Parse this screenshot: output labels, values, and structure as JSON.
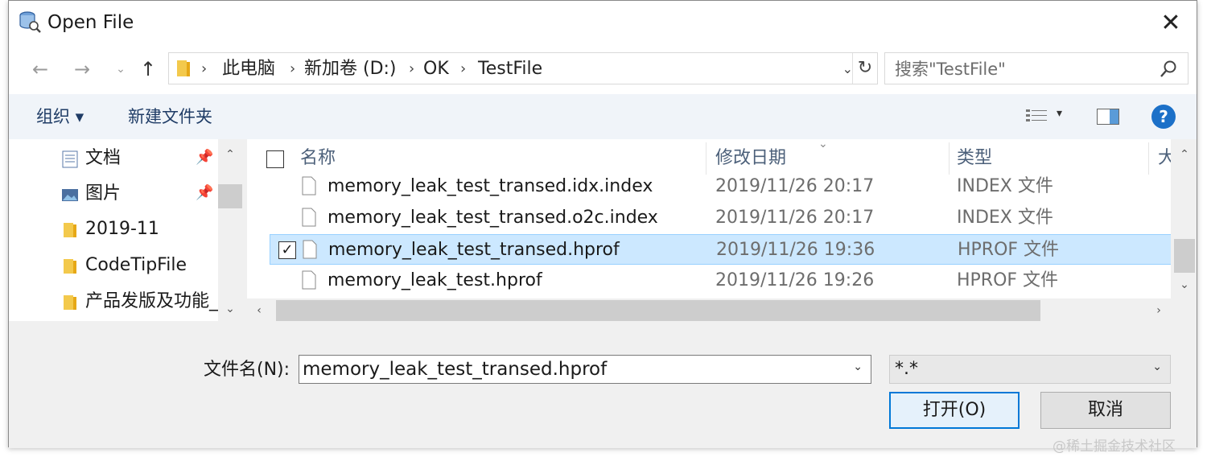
{
  "window": {
    "title": "Open File"
  },
  "nav": {
    "back_icon": "arrow-left",
    "forward_icon": "arrow-right",
    "recent_icon": "chevron-down",
    "up_icon": "arrow-up",
    "breadcrumbs": [
      "此电脑",
      "新加卷 (D:)",
      "OK",
      "TestFile"
    ],
    "search_placeholder": "搜索\"TestFile\""
  },
  "toolbar": {
    "organize": "组织 ▾",
    "new_folder": "新建文件夹",
    "help": "?"
  },
  "sidebar": {
    "items": [
      {
        "label": "文档",
        "icon": "document-icon",
        "pinned": true
      },
      {
        "label": "图片",
        "icon": "picture-icon",
        "pinned": true
      },
      {
        "label": "2019-11",
        "icon": "folder-icon",
        "pinned": false
      },
      {
        "label": "CodeTipFile",
        "icon": "folder-icon",
        "pinned": false
      },
      {
        "label": "产品发版及功能_",
        "icon": "folder-icon",
        "pinned": false
      }
    ]
  },
  "filelist": {
    "columns": {
      "name": "名称",
      "date": "修改日期",
      "type": "类型",
      "size": "大"
    },
    "rows": [
      {
        "name": "memory_leak_test_transed.idx.index",
        "date": "2019/11/26 20:17",
        "type": "INDEX 文件",
        "selected": false,
        "checked": false
      },
      {
        "name": "memory_leak_test_transed.o2c.index",
        "date": "2019/11/26 20:17",
        "type": "INDEX 文件",
        "selected": false,
        "checked": false
      },
      {
        "name": "memory_leak_test_transed.hprof",
        "date": "2019/11/26 19:36",
        "type": "HPROF 文件",
        "selected": true,
        "checked": true
      },
      {
        "name": "memory_leak_test.hprof",
        "date": "2019/11/26 19:26",
        "type": "HPROF 文件",
        "selected": false,
        "checked": false
      }
    ]
  },
  "bottom": {
    "filename_label": "文件名(N):",
    "filename_value": "memory_leak_test_transed.hprof",
    "filetype_value": "*.*",
    "open_label": "打开(O)",
    "cancel_label": "取消"
  },
  "watermark": "@稀土掘金技术社区",
  "colors": {
    "accent": "#0078d7",
    "selection": "#cce8ff",
    "toolbar_text": "#1f3c66",
    "help_bg": "#1c70c8"
  }
}
